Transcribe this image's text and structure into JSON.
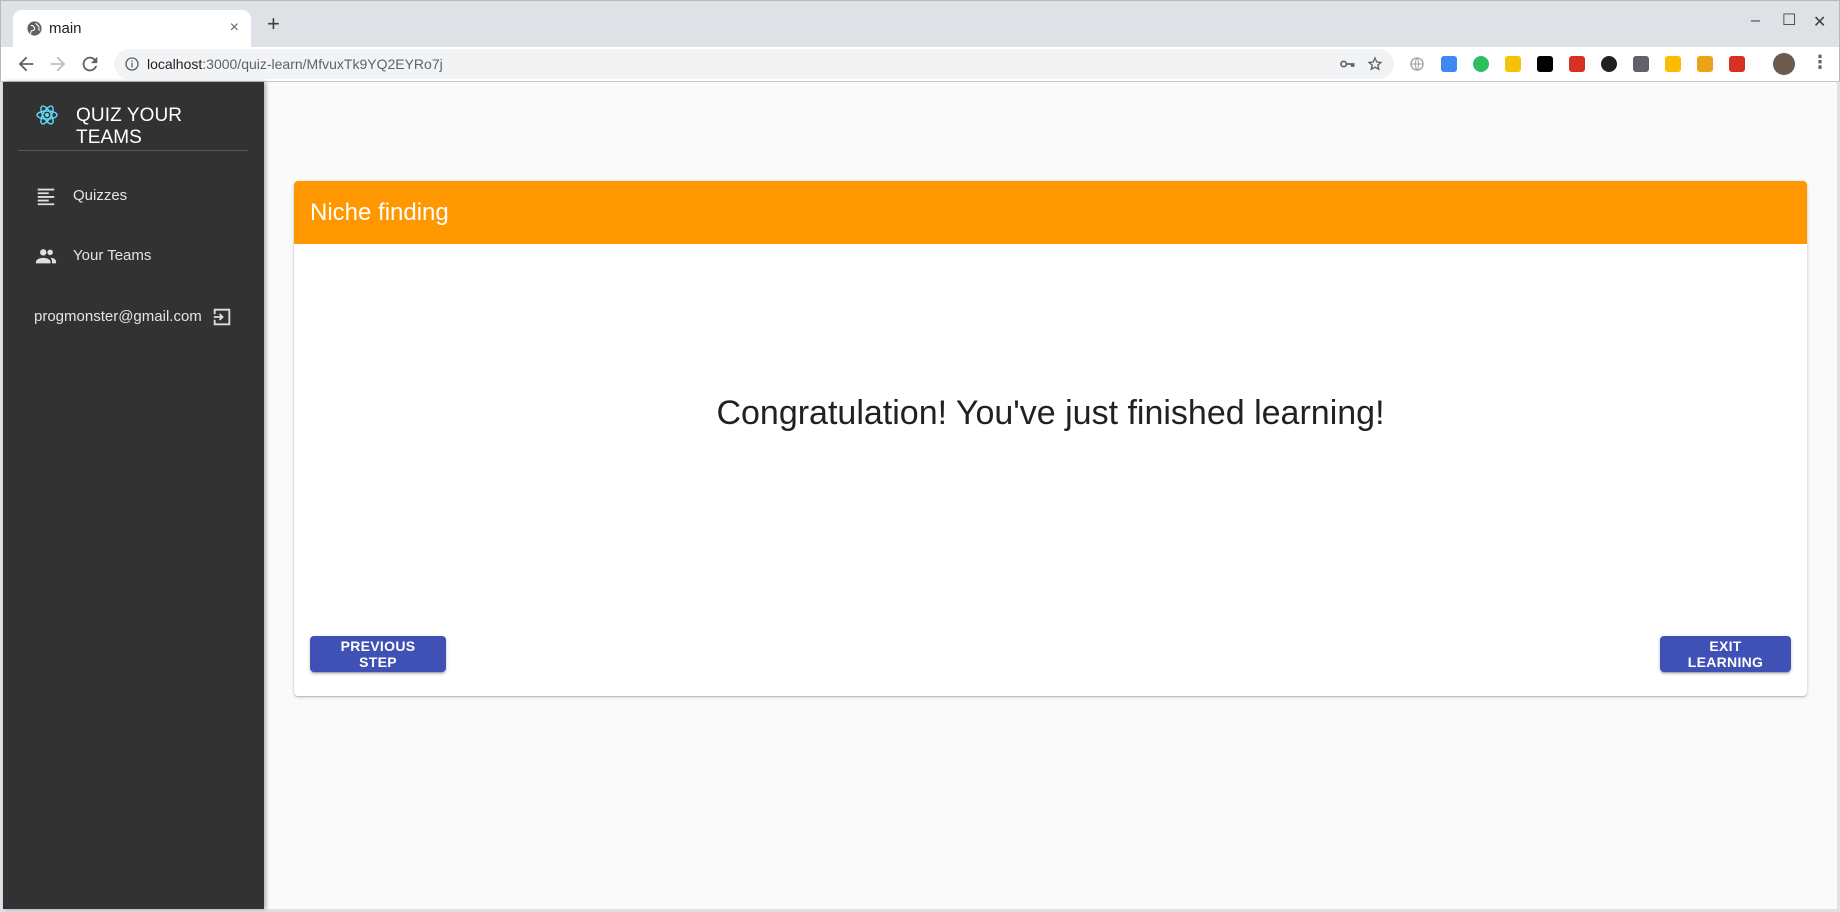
{
  "browser": {
    "tab_title": "main",
    "tab_close": "×",
    "new_tab": "+",
    "url_host": "localhost",
    "url_path": ":3000/quiz-learn/MfvuxTk9YQ2EYRo7j",
    "window_controls": [
      "–",
      "☐",
      "✕"
    ],
    "menu": "⋮"
  },
  "sidebar": {
    "brand": "QUIZ YOUR TEAMS",
    "items": [
      {
        "label": "Quizzes",
        "icon": "list-icon"
      },
      {
        "label": "Your Teams",
        "icon": "people-icon"
      }
    ],
    "user_email": "progmonster@gmail.com"
  },
  "card": {
    "title": "Niche finding",
    "message": "Congratulation! You've just finished learning!",
    "prev_label": "PREVIOUS STEP",
    "exit_label": "EXIT LEARNING"
  },
  "colors": {
    "header": "#ff9800",
    "button": "#3f51b5",
    "sidebar": "#323232"
  }
}
